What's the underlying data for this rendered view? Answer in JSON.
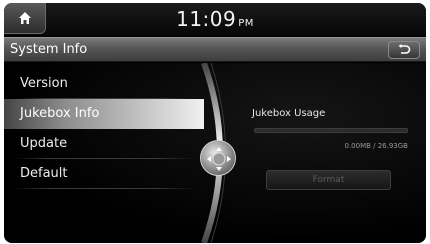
{
  "statusbar": {
    "home_icon": "home-icon",
    "time": "11:09",
    "ampm": "PM"
  },
  "header": {
    "title": "System Info",
    "back_icon": "back-arrow-icon"
  },
  "menu": {
    "items": [
      {
        "label": "Version",
        "selected": false
      },
      {
        "label": "Jukebox Info",
        "selected": true
      },
      {
        "label": "Update",
        "selected": false
      },
      {
        "label": "Default",
        "selected": false
      }
    ]
  },
  "jukebox": {
    "label": "Jukebox Usage",
    "usage_text": "0.00MB / 26.93GB",
    "usage_fraction": 0,
    "format_label": "Format",
    "format_enabled": false
  },
  "colors": {
    "accent": "#e0e0e0",
    "background": "#000000",
    "disabled_text": "#5c5c5c"
  }
}
